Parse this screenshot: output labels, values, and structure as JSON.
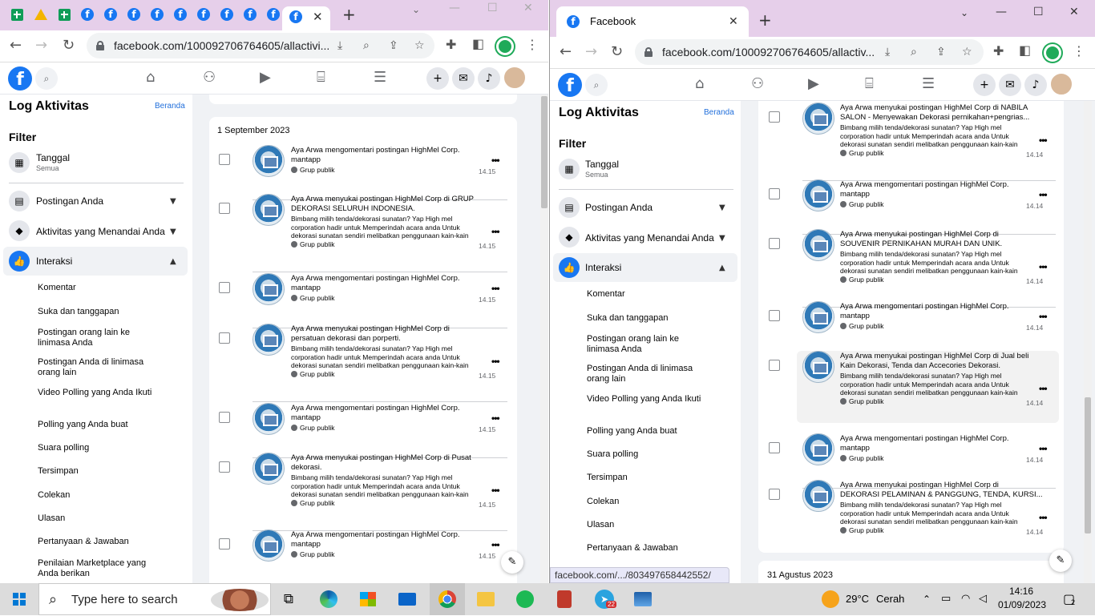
{
  "left_window": {
    "url": "facebook.com/100092706764605/allactivi...",
    "fb_header": {
      "sidebar_title": "Log Aktivitas",
      "home_link": "Beranda"
    },
    "sidebar": {
      "filter_label": "Filter",
      "date_filter": {
        "label": "Tanggal",
        "value": "Semua"
      },
      "sections": [
        {
          "label": "Postingan Anda",
          "icon": "post-icon"
        },
        {
          "label": "Aktivitas yang Menandai Anda",
          "icon": "tag-icon"
        },
        {
          "label": "Interaksi",
          "icon": "thumbs-up-icon"
        }
      ],
      "items": [
        "Komentar",
        "Suka dan tanggapan",
        "Postingan orang lain ke linimasa Anda",
        "Postingan Anda di linimasa orang lain",
        "Video Polling yang Anda Ikuti",
        "Polling yang Anda buat",
        "Suara polling",
        "Tersimpan",
        "Colekan",
        "Ulasan",
        "Pertanyaan & Jawaban",
        "Penilaian Marketplace yang Anda berikan"
      ]
    },
    "date_heading": "1 September 2023",
    "activities": [
      {
        "title": "Aya Arwa mengomentari postingan HighMel Corp.",
        "line2": "mantapp",
        "body": "",
        "audience": "Grup publik",
        "time": "14.15"
      },
      {
        "title": "Aya Arwa menyukai postingan HighMel Corp di GRUP",
        "line2": "DEKORASI SELURUH INDONESIA.",
        "body": "Bimbang milih tenda/dekorasi sunatan? Yap High mel corporation hadir untuk Memperindah acara anda Untuk dekorasi sunatan sendiri melibatkan penggunaan kain-kain warna cerah, bunga-...",
        "audience": "Grup publik",
        "time": "14.15"
      },
      {
        "title": "Aya Arwa mengomentari postingan HighMel Corp.",
        "line2": "mantapp",
        "body": "",
        "audience": "Grup publik",
        "time": "14.15"
      },
      {
        "title": "Aya Arwa menyukai postingan HighMel Corp di",
        "line2": "persatuan dekorasi dan porperti.",
        "body": "Bimbang milih tenda/dekorasi sunatan? Yap High mel corporation hadir untuk Memperindah acara anda Untuk dekorasi sunatan sendiri melibatkan penggunaan kain-kain warna cerah, bunga-...",
        "audience": "Grup publik",
        "time": "14.15"
      },
      {
        "title": "Aya Arwa mengomentari postingan HighMel Corp.",
        "line2": "mantapp",
        "body": "",
        "audience": "Grup publik",
        "time": "14.15"
      },
      {
        "title": "Aya Arwa menyukai postingan HighMel Corp di Pusat",
        "line2": "dekorasi.",
        "body": "Bimbang milih tenda/dekorasi sunatan? Yap High mel corporation hadir untuk Memperindah acara anda Untuk dekorasi sunatan sendiri melibatkan penggunaan kain-kain warna cerah, bunga-...",
        "audience": "Grup publik",
        "time": "14.15"
      },
      {
        "title": "Aya Arwa mengomentari postingan HighMel Corp.",
        "line2": "mantapp",
        "body": "",
        "audience": "Grup publik",
        "time": "14.15"
      }
    ]
  },
  "right_window": {
    "tab_title": "Facebook",
    "url": "facebook.com/100092706764605/allactiv...",
    "status_url": "facebook.com/.../803497658442552/",
    "fb_header": {
      "sidebar_title": "Log Aktivitas",
      "home_link": "Beranda"
    },
    "sidebar": {
      "filter_label": "Filter",
      "date_filter": {
        "label": "Tanggal",
        "value": "Semua"
      },
      "sections": [
        {
          "label": "Postingan Anda",
          "icon": "post-icon"
        },
        {
          "label": "Aktivitas yang Menandai Anda",
          "icon": "tag-icon"
        },
        {
          "label": "Interaksi",
          "icon": "thumbs-up-icon"
        }
      ],
      "items": [
        "Komentar",
        "Suka dan tanggapan",
        "Postingan orang lain ke linimasa Anda",
        "Postingan Anda di linimasa orang lain",
        "Video Polling yang Anda Ikuti",
        "Polling yang Anda buat",
        "Suara polling",
        "Tersimpan",
        "Colekan",
        "Ulasan",
        "Pertanyaan & Jawaban"
      ]
    },
    "date_heading_bottom": "31 Agustus 2023",
    "activities": [
      {
        "title": "Aya Arwa menyukai postingan HighMel Corp di NABILA",
        "line2": "SALON - Menyewakan Dekorasi pernikahan+pengrias...",
        "body": "Bimbang milih tenda/dekorasi sunatan? Yap High mel corporation hadir untuk Memperindah acara anda Untuk dekorasi sunatan sendiri melibatkan penggunaan kain-kain warna cerah, bunga-...",
        "audience": "Grup publik",
        "time": "14.14"
      },
      {
        "title": "Aya Arwa mengomentari postingan HighMel Corp.",
        "line2": "mantapp",
        "body": "",
        "audience": "Grup publik",
        "time": "14.14"
      },
      {
        "title": "Aya Arwa menyukai postingan HighMel Corp di",
        "line2": "SOUVENIR PERNIKAHAN MURAH DAN UNIK.",
        "body": "Bimbang milih tenda/dekorasi sunatan? Yap High mel corporation hadir untuk Memperindah acara anda Untuk dekorasi sunatan sendiri melibatkan penggunaan kain-kain warna cerah, bunga-...",
        "audience": "Grup publik",
        "time": "14.14"
      },
      {
        "title": "Aya Arwa mengomentari postingan HighMel Corp.",
        "line2": "mantapp",
        "body": "",
        "audience": "Grup publik",
        "time": "14.14"
      },
      {
        "title": "Aya Arwa menyukai postingan HighMel Corp di Jual beli",
        "line2": "Kain Dekorasi, Tenda dan Accecories Dekorasi.",
        "body": "Bimbang milih tenda/dekorasi sunatan? Yap High mel corporation hadir untuk Memperindah acara anda Untuk dekorasi sunatan sendiri melibatkan penggunaan kain-kain warna cerah, bunga-...",
        "audience": "Grup publik",
        "time": "14.14"
      },
      {
        "title": "Aya Arwa mengomentari postingan HighMel Corp.",
        "line2": "mantapp",
        "body": "",
        "audience": "Grup publik",
        "time": "14.14"
      },
      {
        "title": "Aya Arwa menyukai postingan HighMel Corp di",
        "line2": "DEKORASI PELAMINAN & PANGGUNG, TENDA, KURSI...",
        "body": "Bimbang milih tenda/dekorasi sunatan? Yap High mel corporation hadir untuk Memperindah acara anda Untuk dekorasi sunatan sendiri melibatkan penggunaan kain-kain warna cerah, bunga-...",
        "audience": "Grup publik",
        "time": "14.14"
      }
    ]
  },
  "taskbar": {
    "search_placeholder": "Type here to search",
    "weather_temp": "29°C",
    "weather_text": "Cerah",
    "time": "14:16",
    "date": "01/09/2023",
    "notification_count": "2",
    "telegram_badge": "22"
  },
  "colors": {
    "fb_blue": "#1877f2",
    "tabbar": "#e6cfea",
    "main_bg": "#f0f2f5"
  }
}
